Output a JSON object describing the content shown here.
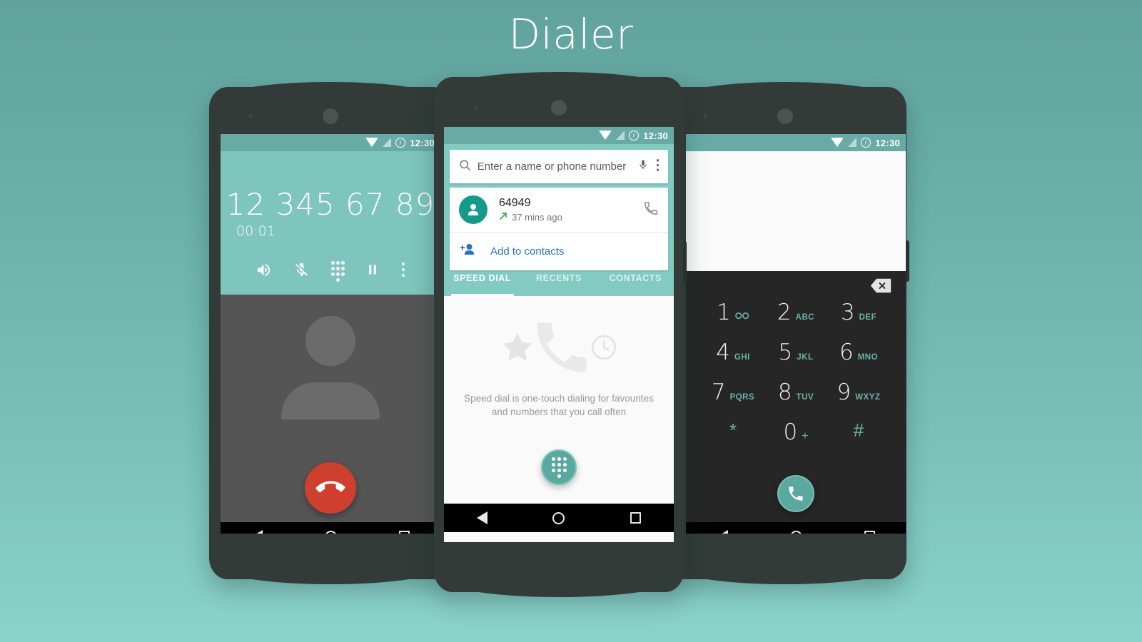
{
  "page": {
    "title": "Dialer",
    "background_top": "#61a29d",
    "background_bottom": "#8ad2ca",
    "accent_teal": "#7ec6bd",
    "accent_dark": "#262626",
    "link_blue": "#2a6fc9",
    "danger_red": "#cf3f2e",
    "contact_green": "#139a8a"
  },
  "status_bar": {
    "time": "12:30",
    "icons": [
      "wifi-icon",
      "signal-icon",
      "battery-charging-icon"
    ]
  },
  "nav_bar": {
    "back_label": "back-icon",
    "home_label": "home-icon",
    "recents_label": "recents-icon"
  },
  "phone1": {
    "screen_name": "in-call-screen",
    "number": "12 345 67 89",
    "timer": "00:01",
    "actions": [
      {
        "name": "speaker-icon",
        "label": "Speaker"
      },
      {
        "name": "mic-off-icon",
        "label": "Mute"
      },
      {
        "name": "dialpad-icon",
        "label": "Dialpad"
      },
      {
        "name": "pause-icon",
        "label": "Hold"
      },
      {
        "name": "more-vert-icon",
        "label": "More options"
      }
    ],
    "end_call_label": "End call"
  },
  "phone2": {
    "screen_name": "search-speed-dial-screen",
    "search": {
      "placeholder": "Enter a name or phone number",
      "search_icon": "search-icon",
      "mic_icon": "mic-icon",
      "overflow_icon": "more-vert-icon"
    },
    "result": {
      "name": "64949",
      "time": "37 mins ago",
      "call_type_icon": "outgoing-call-arrow",
      "call_icon": "phone-icon"
    },
    "add_contact": {
      "label": "Add to contacts",
      "icon": "person-add-icon"
    },
    "tabs": [
      {
        "label": "SPEED DIAL",
        "active": true
      },
      {
        "label": "RECENTS",
        "active": false
      },
      {
        "label": "CONTACTS",
        "active": false
      }
    ],
    "empty_state": {
      "line1": "Speed dial is one-touch dialing for favourites",
      "line2": "and numbers that you call often",
      "icons": [
        "star-icon",
        "phone-icon",
        "clock-icon"
      ]
    },
    "fab_label": "dialpad-fab"
  },
  "phone3": {
    "screen_name": "dialpad-screen",
    "input_value": "",
    "backspace_label": "backspace-icon",
    "keys": [
      {
        "num": "1",
        "sub": "",
        "icon": "voicemail-icon"
      },
      {
        "num": "2",
        "sub": "ABC",
        "icon": ""
      },
      {
        "num": "3",
        "sub": "DEF",
        "icon": ""
      },
      {
        "num": "4",
        "sub": "GHI",
        "icon": ""
      },
      {
        "num": "5",
        "sub": "JKL",
        "icon": ""
      },
      {
        "num": "6",
        "sub": "MNO",
        "icon": ""
      },
      {
        "num": "7",
        "sub": "PQRS",
        "icon": ""
      },
      {
        "num": "8",
        "sub": "TUV",
        "icon": ""
      },
      {
        "num": "9",
        "sub": "WXYZ",
        "icon": ""
      },
      {
        "num": "*",
        "sub": "",
        "icon": ""
      },
      {
        "num": "0",
        "sub": "+",
        "icon": ""
      },
      {
        "num": "#",
        "sub": "",
        "icon": ""
      }
    ],
    "call_fab_label": "call-fab"
  }
}
